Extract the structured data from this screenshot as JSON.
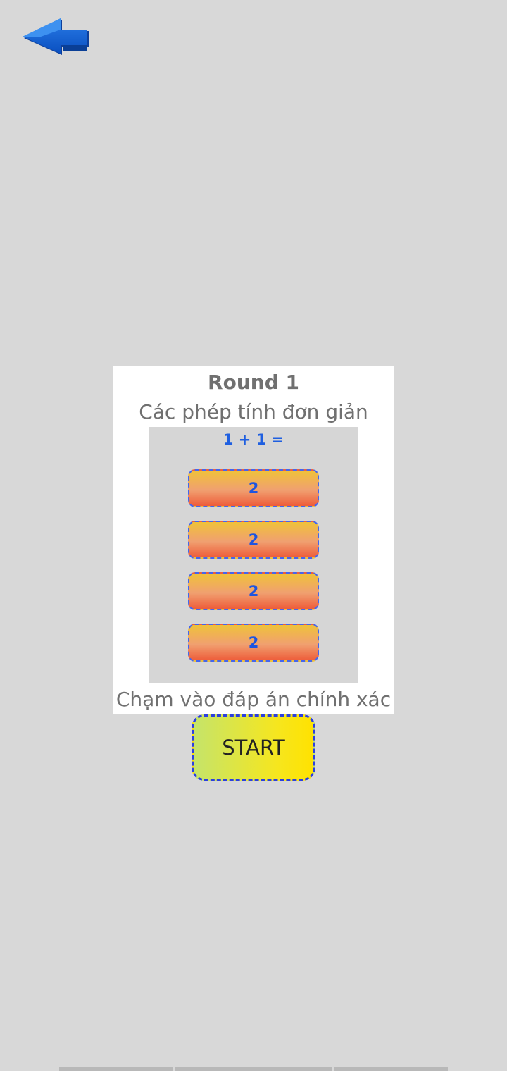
{
  "header": {
    "back_icon": "blue-left-arrow-icon"
  },
  "card": {
    "round_title": "Round 1",
    "subtitle": "Các phép tính đơn giản",
    "preview": {
      "question": "1 + 1 =",
      "answers": [
        "2",
        "2",
        "2",
        "2"
      ]
    },
    "instruction": "Chạm vào đáp án chính xác"
  },
  "start_button": {
    "label": "START"
  },
  "colors": {
    "background": "#d8d8d8",
    "accent_blue": "#1f5fe0",
    "muted_text": "#707070"
  }
}
